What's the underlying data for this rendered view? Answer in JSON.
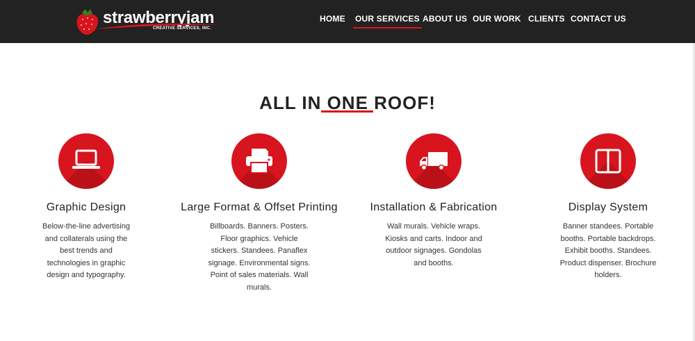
{
  "brand": {
    "name": "strawberryjam",
    "tagline": "CREATIVE SERVICES, INC."
  },
  "nav": {
    "items": [
      {
        "label": "HOME",
        "active": false
      },
      {
        "label": "OUR SERVICES",
        "active": true
      },
      {
        "label": "ABOUT US",
        "active": false
      },
      {
        "label": "OUR WORK",
        "active": false
      },
      {
        "label": "CLIENTS",
        "active": false
      },
      {
        "label": "CONTACT US",
        "active": false
      }
    ]
  },
  "section": {
    "title": "ALL IN ONE ROOF!"
  },
  "services": [
    {
      "icon": "laptop-icon",
      "title": "Graphic Design",
      "text": "Below-the-line advertising and collaterals using the best trends and technologies in graphic design and typography."
    },
    {
      "icon": "printer-icon",
      "title": "Large Format & Offset Printing",
      "text": "Billboards. Banners. Posters. Floor graphics. Vehicle stickers. Standees. Panaflex signage. Environmental signs. Point of sales materials. Wall murals."
    },
    {
      "icon": "truck-icon",
      "title": "Installation & Fabrication",
      "text": "Wall murals. Vehicle wraps. Kiosks and carts. Indoor and outdoor signages. Gondolas and booths."
    },
    {
      "icon": "columns-icon",
      "title": "Display System",
      "text": "Banner standees. Portable booths. Portable backdrops. Exhibit booths. Standees. Product dispenser. Brochure holders."
    }
  ],
  "colors": {
    "accent": "#d8141e",
    "topbar": "#222222",
    "text": "#222222"
  }
}
